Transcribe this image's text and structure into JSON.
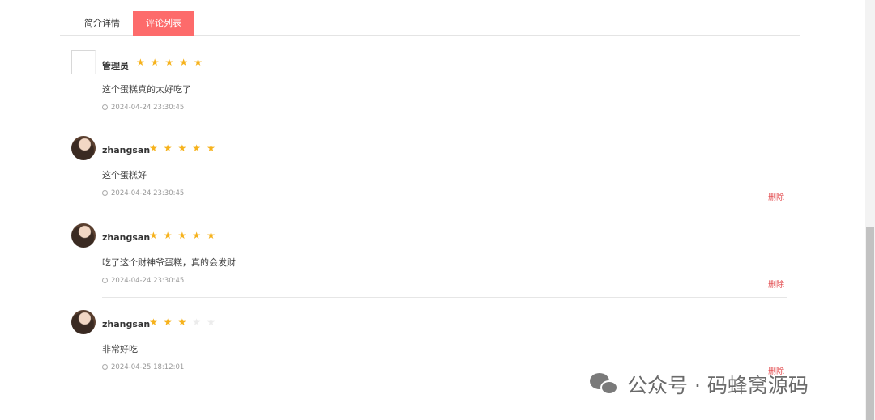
{
  "tabs": [
    {
      "label": "简介详情",
      "active": false
    },
    {
      "label": "评论列表",
      "active": true
    }
  ],
  "comments": [
    {
      "user": "管理员",
      "rating": 5,
      "content": "这个蛋糕真的太好吃了",
      "time": "2024-04-24 23:30:45",
      "delete_label": "",
      "avatar": "broken-image"
    },
    {
      "user": "zhangsan",
      "rating": 5,
      "content": "这个蛋糕好",
      "time": "2024-04-24 23:30:45",
      "delete_label": "删除",
      "avatar": "user-photo"
    },
    {
      "user": "zhangsan",
      "rating": 5,
      "content": "吃了这个财神爷蛋糕，真的会发财",
      "time": "2024-04-24 23:30:45",
      "delete_label": "删除",
      "avatar": "user-photo"
    },
    {
      "user": "zhangsan",
      "rating": 3,
      "content": "非常好吃",
      "time": "2024-04-25 18:12:01",
      "delete_label": "删除",
      "avatar": "user-photo"
    }
  ],
  "star_max": 5,
  "watermark": {
    "text": "公众号 · 码蜂窝源码"
  },
  "colors": {
    "accent": "#fd6b6b",
    "star": "#f6b21c",
    "delete": "#e2474a"
  }
}
